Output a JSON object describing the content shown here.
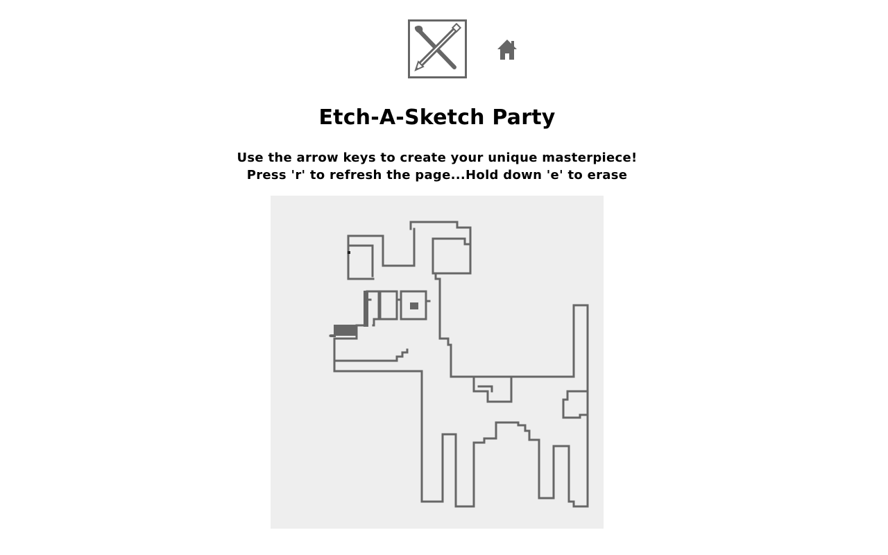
{
  "header": {
    "logo_icon": "paintbrush-pencil-cross-icon",
    "home_icon": "home-icon"
  },
  "page": {
    "title": "Etch-A-Sketch Party",
    "instruction_line_1": "Use the arrow keys to create your unique masterpiece!",
    "instruction_line_2": "Press 'r' to refresh the page...Hold down 'e' to erase"
  },
  "board": {
    "background_color": "#eeeeee",
    "ink_color": "#666666",
    "cursor_color": "#222222",
    "drawing": "dog"
  }
}
